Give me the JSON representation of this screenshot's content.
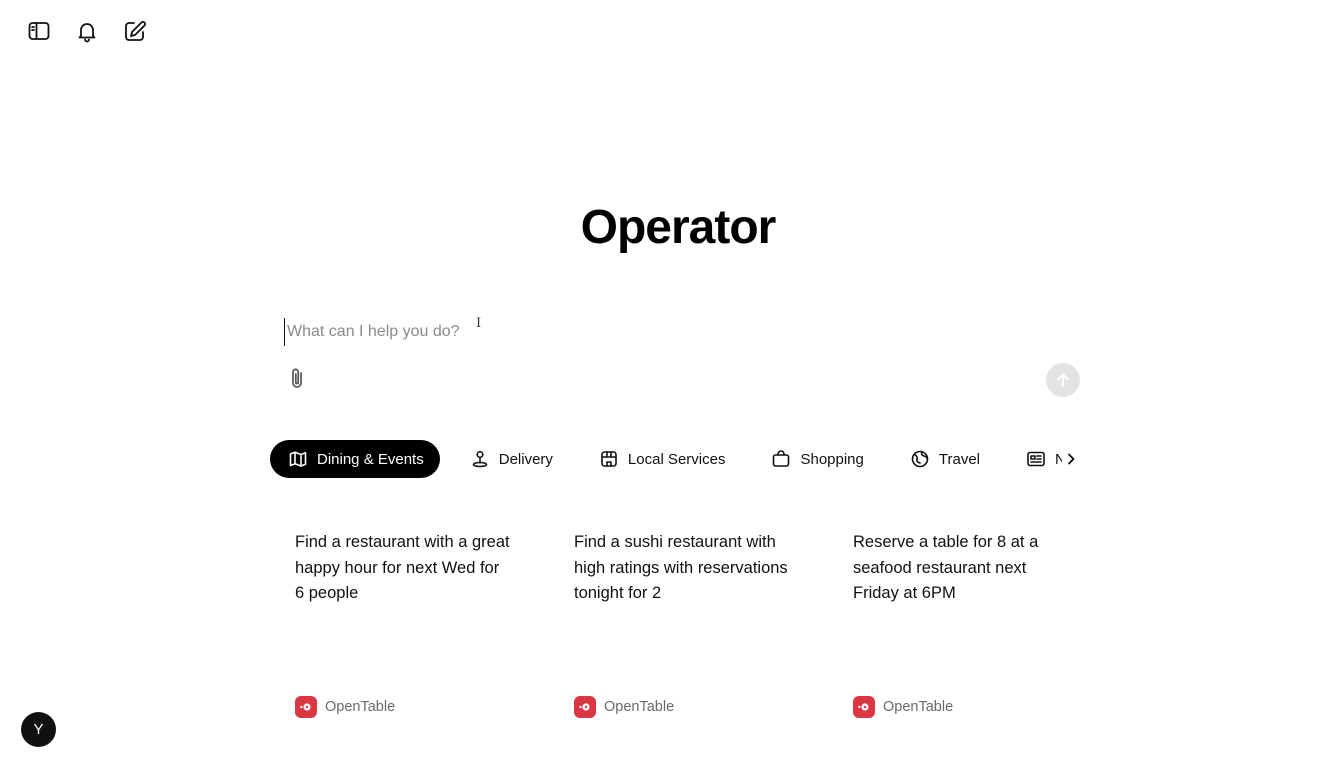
{
  "header": {
    "icons": [
      "sidebar-toggle-icon",
      "bell-icon",
      "compose-icon"
    ]
  },
  "main": {
    "title": "Operator"
  },
  "prompt": {
    "placeholder": "What can I help you do?",
    "value": ""
  },
  "tabs": [
    {
      "label": "Dining & Events",
      "icon": "map-icon",
      "active": true
    },
    {
      "label": "Delivery",
      "icon": "map-pin-icon",
      "active": false
    },
    {
      "label": "Local Services",
      "icon": "storefront-icon",
      "active": false
    },
    {
      "label": "Shopping",
      "icon": "shopping-bag-icon",
      "active": false
    },
    {
      "label": "Travel",
      "icon": "globe-icon",
      "active": false
    },
    {
      "label": "News",
      "icon": "newspaper-icon",
      "active": false
    }
  ],
  "cards": [
    {
      "text": "Find a restaurant with a great happy hour for next Wed for 6 people",
      "source": "OpenTable"
    },
    {
      "text": "Find a sushi restaurant with high ratings with reservations tonight for 2",
      "source": "OpenTable"
    },
    {
      "text": "Reserve a table for 8 at a seafood restaurant next Friday at 6PM",
      "source": "OpenTable"
    }
  ],
  "user": {
    "avatar_initial": "Y"
  },
  "colors": {
    "active_tab_bg": "#000000",
    "send_button_bg": "#e3e3e3",
    "opentable_brand": "#da3743"
  }
}
